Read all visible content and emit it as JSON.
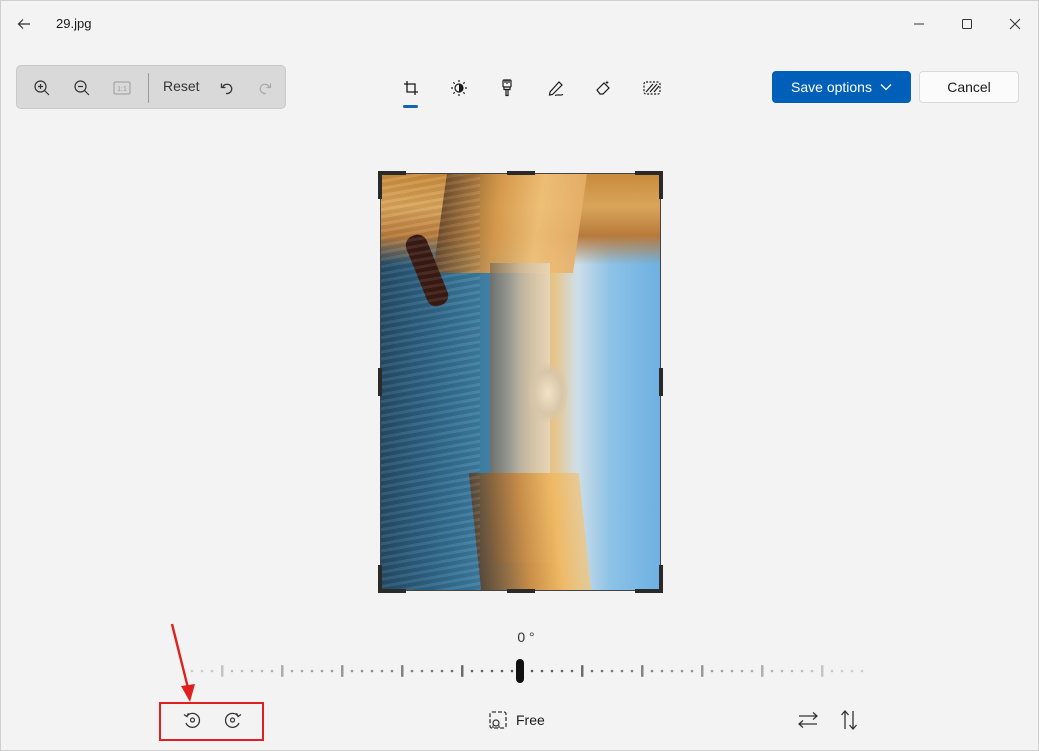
{
  "window": {
    "title": "29.jpg"
  },
  "toolbar": {
    "reset_label": "Reset",
    "actual_size_label": "1:1"
  },
  "edit_tabs": [
    "crop-icon",
    "adjust-icon",
    "filter-icon",
    "markup-icon",
    "erase-icon",
    "background-blur-icon"
  ],
  "actions": {
    "save_label": "Save options",
    "cancel_label": "Cancel"
  },
  "crop": {
    "angle_label": "0 °",
    "aspect_label": "Free"
  },
  "colors": {
    "accent": "#005fb8",
    "annotation": "#e02020"
  }
}
